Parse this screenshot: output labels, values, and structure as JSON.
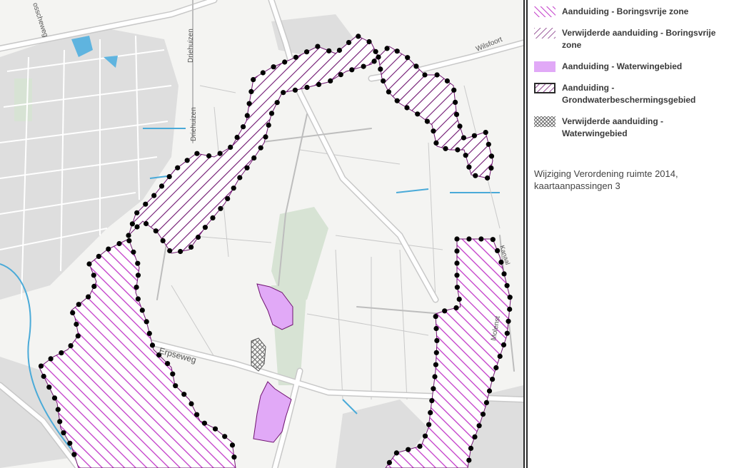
{
  "map": {
    "street_labels": {
      "erpseweg": "Erpseweg",
      "driehuizen_1": "Driehuizen",
      "driehuizen_2": "Driehuizen",
      "wilsfoort": "Wilsfoort",
      "bosscheweg": "osscheweg",
      "kanaal": "Kanaal",
      "molenweg": "Molenst"
    },
    "colors": {
      "hatch_magenta": "#c23bc9",
      "hatch_dark": "#6f1470",
      "waterwingebied_fill": "#e1a9f7",
      "crosshatch": "#6a6a6a",
      "marker": "#000000",
      "water": "#4aaad8",
      "road": "#ffffff",
      "built_area": "#dcdcdc",
      "background": "#f4f4f2"
    }
  },
  "legend": {
    "items": [
      {
        "label": "Aanduiding - Boringsvrije zone",
        "swatch": "hatch-magenta-icon"
      },
      {
        "label": "Verwijderde aanduiding - Boringsvrije zone",
        "swatch": "hatch-dark-thin-icon"
      },
      {
        "label": "Aanduiding - Waterwingebied",
        "swatch": "solid-lilac-icon"
      },
      {
        "label": "Aanduiding - Grondwaterbeschermingsgebied",
        "swatch": "hatch-dark-border-icon"
      },
      {
        "label": "Verwijderde aanduiding - Waterwingebied",
        "swatch": "crosshatch-icon"
      }
    ],
    "note": "Wijziging Verordening ruimte 2014, kaartaanpassingen 3"
  }
}
